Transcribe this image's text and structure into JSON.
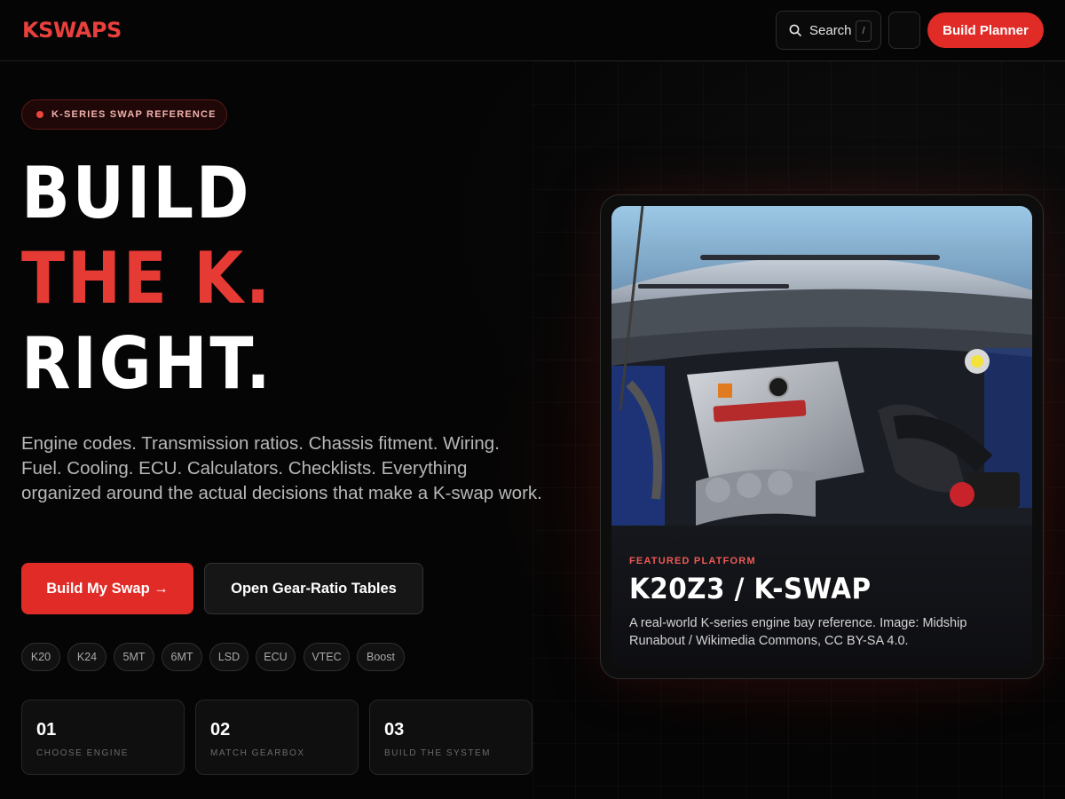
{
  "header": {
    "logo": "KSWAPS",
    "search_label": "Search",
    "search_shortcut": "/",
    "planner_label": "Build Planner"
  },
  "hero": {
    "eyebrow": "K-SERIES SWAP REFERENCE",
    "headline": [
      "BUILD",
      "THE K.",
      "RIGHT."
    ],
    "intro": "Engine codes. Transmission ratios. Chassis fitment. Wiring. Fuel. Cooling. ECU. Calculators. Checklists. Everything organized around the actual decisions that make a K-swap work.",
    "primary_cta": "Build My Swap →",
    "secondary_cta": "Open Gear-Ratio Tables",
    "tags": [
      "K20",
      "K24",
      "5MT",
      "6MT",
      "LSD",
      "ECU",
      "VTEC",
      "Boost"
    ]
  },
  "steps": [
    {
      "num": "01",
      "label": "CHOOSE ENGINE"
    },
    {
      "num": "02",
      "label": "MATCH GEARBOX"
    },
    {
      "num": "03",
      "label": "BUILD THE SYSTEM"
    }
  ],
  "featured": {
    "label": "FEATURED PLATFORM",
    "title": "K20Z3 / K-SWAP",
    "description": "A real-world K-series engine bay reference. Image: Midship Runabout / Wikimedia Commons, CC BY-SA 4.0.",
    "image_icon": "engine-bay-photo"
  },
  "colors": {
    "accent": "#e02b27",
    "background": "#050505",
    "headline_red": "#e63a35"
  }
}
